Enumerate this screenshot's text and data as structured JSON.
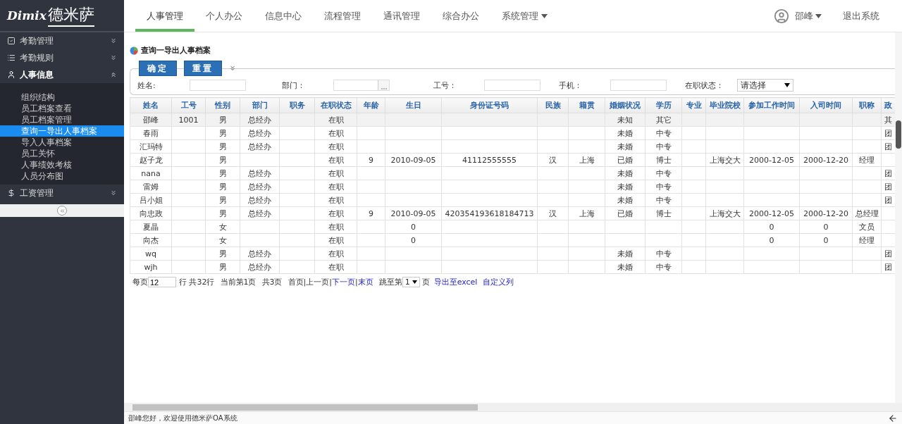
{
  "logo": {
    "latin": "Dimix",
    "cn": "德米萨"
  },
  "nav": {
    "items": [
      {
        "label": "人事管理",
        "selected": true,
        "dropdown": false
      },
      {
        "label": "个人办公",
        "selected": false,
        "dropdown": false
      },
      {
        "label": "信息中心",
        "selected": false,
        "dropdown": false
      },
      {
        "label": "流程管理",
        "selected": false,
        "dropdown": false
      },
      {
        "label": "通讯管理",
        "selected": false,
        "dropdown": false
      },
      {
        "label": "综合办公",
        "selected": false,
        "dropdown": false
      },
      {
        "label": "系统管理",
        "selected": false,
        "dropdown": true
      }
    ],
    "user": "邵峰",
    "logout": "退出系统"
  },
  "sidebar": {
    "groups": [
      {
        "label": "考勤管理",
        "expanded": false
      },
      {
        "label": "考勤规则",
        "expanded": false
      },
      {
        "label": "人事信息",
        "expanded": true,
        "children": [
          {
            "label": "组织结构",
            "selected": false
          },
          {
            "label": "员工档案查看",
            "selected": false
          },
          {
            "label": "员工档案管理",
            "selected": false
          },
          {
            "label": "查询一导出人事档案",
            "selected": true
          },
          {
            "label": "导入人事档案",
            "selected": false
          },
          {
            "label": "员工关怀",
            "selected": false
          },
          {
            "label": "人事绩效考核",
            "selected": false
          },
          {
            "label": "人员分布图",
            "selected": false
          }
        ]
      },
      {
        "label": "工资管理",
        "expanded": false
      }
    ]
  },
  "page": {
    "title": "查询一导出人事档案",
    "buttons": [
      "确定",
      "重置"
    ],
    "filters": [
      {
        "label": "姓名:",
        "kind": "text"
      },
      {
        "label": "部门：",
        "kind": "picker"
      },
      {
        "label": "工号：",
        "kind": "text"
      },
      {
        "label": "手机：",
        "kind": "text"
      },
      {
        "label": "在职状态：",
        "kind": "select",
        "value": "请选择"
      }
    ],
    "table": {
      "columns": [
        "姓名",
        "工号",
        "性别",
        "部门",
        "职务",
        "在职状态",
        "年龄",
        "生日",
        "身份证号码",
        "民族",
        "籍贯",
        "婚姻状况",
        "学历",
        "专业",
        "毕业院校",
        "参加工作时间",
        "入司时间",
        "职称",
        "政"
      ],
      "rows": [
        {
          "selected": true,
          "cells": {
            "0": "邵峰",
            "1": "1001",
            "2": "男",
            "3": "总经办",
            "5": "在职",
            "11": "未知",
            "12": "其它",
            "18": "其"
          }
        },
        {
          "selected": false,
          "cells": {
            "0": "春雨",
            "2": "男",
            "3": "总经办",
            "5": "在职",
            "11": "未婚",
            "12": "中专",
            "18": "团"
          }
        },
        {
          "selected": false,
          "cells": {
            "0": "汇玛特",
            "2": "男",
            "3": "总经办",
            "5": "在职",
            "11": "未婚",
            "12": "中专",
            "18": "团"
          }
        },
        {
          "selected": false,
          "cells": {
            "0": "赵子龙",
            "2": "男",
            "5": "在职",
            "6": "9",
            "7": "2010-09-05",
            "8": "41112555555",
            "9": "汉",
            "10": "上海",
            "11": "已婚",
            "12": "博士",
            "14": "上海交大",
            "15": "2000-12-05",
            "16": "2000-12-20",
            "17": "经理"
          }
        },
        {
          "selected": false,
          "cells": {
            "0": "nana",
            "2": "男",
            "3": "总经办",
            "5": "在职",
            "11": "未婚",
            "12": "中专",
            "18": "团"
          }
        },
        {
          "selected": false,
          "cells": {
            "0": "雷姆",
            "2": "男",
            "3": "总经办",
            "5": "在职",
            "11": "未婚",
            "12": "中专",
            "18": "团"
          }
        },
        {
          "selected": false,
          "cells": {
            "0": "吕小姐",
            "2": "男",
            "3": "总经办",
            "5": "在职",
            "11": "未婚",
            "12": "中专",
            "18": "团"
          }
        },
        {
          "selected": false,
          "cells": {
            "0": "向忠政",
            "2": "男",
            "3": "总经办",
            "5": "在职",
            "6": "9",
            "7": "2010-09-05",
            "8": "420354193618184713",
            "9": "汉",
            "10": "上海",
            "11": "已婚",
            "12": "博士",
            "14": "上海交大",
            "15": "2000-12-05",
            "16": "2000-12-20",
            "17": "总经理"
          }
        },
        {
          "selected": false,
          "cells": {
            "0": "夏晶",
            "2": "女",
            "5": "在职",
            "7": "0",
            "15": "0",
            "16": "0",
            "17": "文员"
          }
        },
        {
          "selected": false,
          "cells": {
            "0": "向杰",
            "2": "女",
            "5": "在职",
            "7": "0",
            "15": "0",
            "16": "0",
            "17": "经理"
          }
        },
        {
          "selected": false,
          "cells": {
            "0": "wq",
            "2": "男",
            "3": "总经办",
            "5": "在职",
            "11": "未婚",
            "12": "中专",
            "18": "团"
          }
        },
        {
          "selected": false,
          "cells": {
            "0": "wjh",
            "2": "男",
            "3": "总经办",
            "5": "在职",
            "11": "未婚",
            "12": "中专",
            "18": "团"
          }
        }
      ]
    },
    "pager": {
      "per_page_label": "每页",
      "per_page": "12",
      "summary": [
        "行 共32行",
        "当前第1页",
        "共3页"
      ],
      "separator": "|",
      "links": [
        {
          "label": "首页",
          "disabled": true
        },
        {
          "label": "上一页",
          "disabled": true
        },
        {
          "label": "下一页",
          "disabled": false
        },
        {
          "label": "末页",
          "disabled": false
        }
      ],
      "jump_label": "跳至第",
      "jump_page": "1",
      "jump_suffix": "页",
      "actions": [
        "导出至excel",
        "自定义列"
      ]
    }
  },
  "status_bar": "邵峰您好，欢迎使用德米萨OA系统"
}
